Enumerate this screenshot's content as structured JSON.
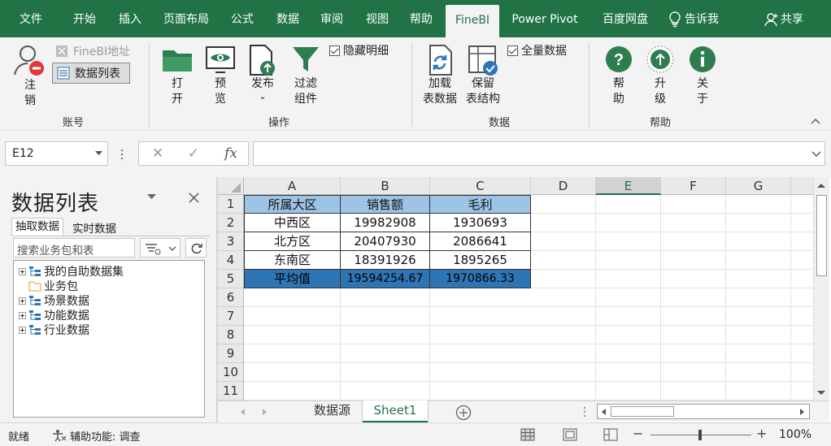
{
  "ribbon_tabs": [
    "文件",
    "开始",
    "插入",
    "页面布局",
    "公式",
    "数据",
    "审阅",
    "视图",
    "帮助",
    "FineBI",
    "Power Pivot",
    "百度网盘"
  ],
  "tell_me": "告诉我",
  "share": "共享",
  "account_group": {
    "logout_line1": "注",
    "logout_line2": "销",
    "finebi_address": "FineBI地址",
    "data_list": "数据列表",
    "label": "账号"
  },
  "operation_group": {
    "open": [
      "打",
      "开"
    ],
    "preview": [
      "预",
      "览"
    ],
    "publish": "发布",
    "publish_caret": "⌄",
    "filter": [
      "过滤",
      "组件"
    ],
    "hide_detail": "隐藏明细",
    "label": "操作"
  },
  "data_group": {
    "load": [
      "加载",
      "表数据"
    ],
    "keep": [
      "保留",
      "表结构"
    ],
    "full_data": "全量数据",
    "label": "数据"
  },
  "help_group": {
    "help": [
      "帮",
      "助"
    ],
    "upgrade": [
      "升",
      "级"
    ],
    "about": [
      "关",
      "于"
    ],
    "label": "帮助"
  },
  "formula_bar": {
    "name_box": "E12",
    "fx": "fx",
    "cancel": "✕",
    "confirm": "✓",
    "content": ""
  },
  "pane": {
    "title": "数据列表",
    "tab_extract": "抽取数据",
    "tab_realtime": "实时数据",
    "search_placeholder": "搜索业务包和表",
    "tree": [
      "我的自助数据集",
      "业务包",
      "场景数据",
      "功能数据",
      "行业数据"
    ]
  },
  "grid": {
    "columns": [
      "A",
      "B",
      "C",
      "D",
      "E",
      "F",
      "G"
    ],
    "rows": [
      "1",
      "2",
      "3",
      "4",
      "5",
      "6",
      "7",
      "8",
      "9",
      "10",
      "11"
    ],
    "header": [
      "所属大区",
      "销售额",
      "毛利"
    ],
    "data": [
      [
        "中西区",
        "19982908",
        "1930693"
      ],
      [
        "北方区",
        "20407930",
        "2086641"
      ],
      [
        "东南区",
        "18391926",
        "1895265"
      ]
    ],
    "avg": [
      "平均值",
      "19594254.67",
      "1970866.33"
    ]
  },
  "sheets": [
    "数据源",
    "Sheet1"
  ],
  "status": {
    "ready": "就绪",
    "accessibility": "辅助功能: 调查",
    "zoom": "100%",
    "zoom_minus": "−",
    "zoom_plus": "+"
  },
  "colors": {
    "excel_green": "#217346",
    "header_fill": "#9dc3e6",
    "avg_fill": "#2e75b6",
    "fine_green": "#2e7d4f"
  }
}
